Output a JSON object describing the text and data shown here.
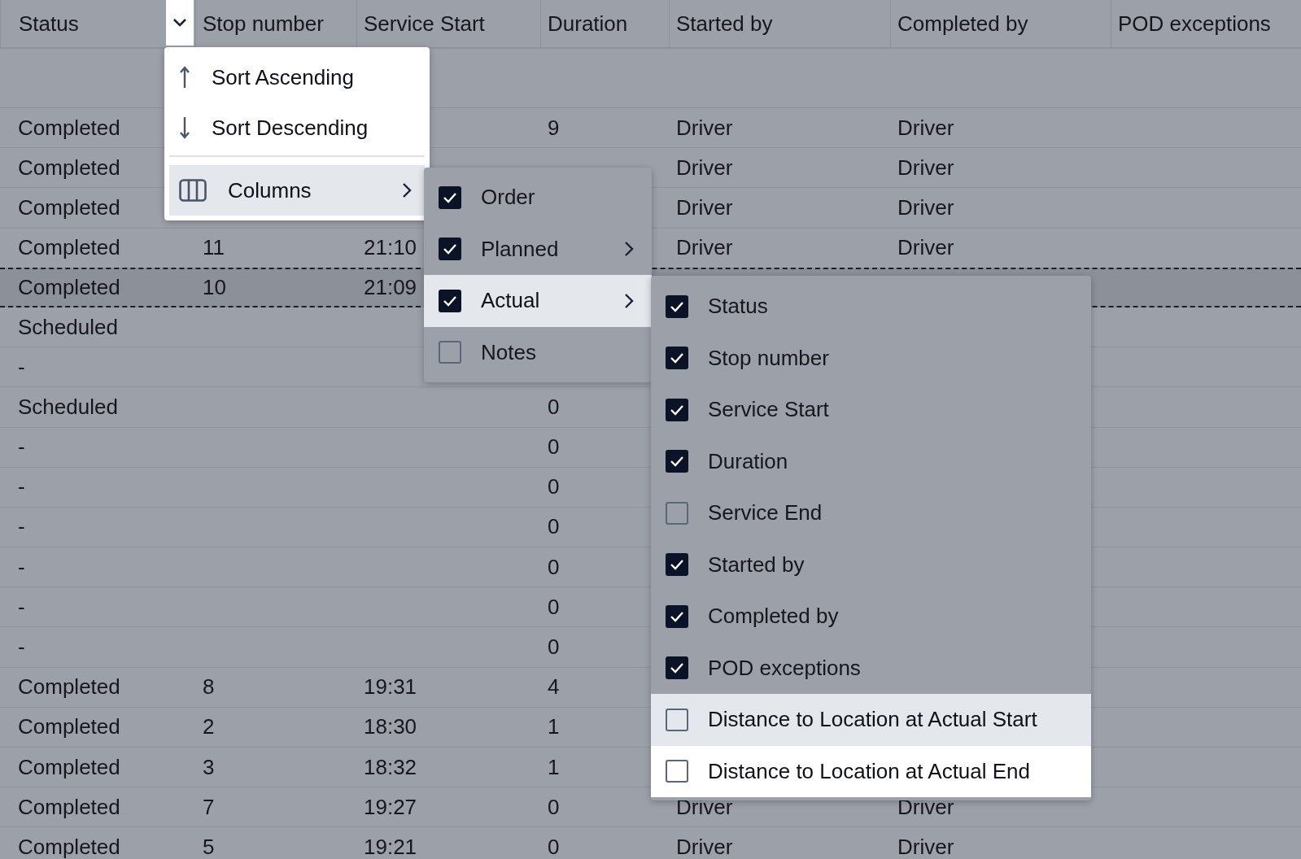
{
  "table": {
    "columns": [
      "Status",
      "Stop number",
      "Service Start",
      "Duration",
      "Started by",
      "Completed by",
      "POD exceptions"
    ],
    "rows": [
      {
        "status": "Completed",
        "duration": "9",
        "started_by": "Driver",
        "completed_by": "Driver",
        "selected": false
      },
      {
        "status": "Completed",
        "started_by": "Driver",
        "completed_by": "Driver",
        "selected": false
      },
      {
        "status": "Completed",
        "started_by": "Driver",
        "completed_by": "Driver",
        "selected": false
      },
      {
        "status": "Completed",
        "stop_number": "11",
        "service_start": "21:10",
        "started_by": "Driver",
        "completed_by": "Driver",
        "selected": false
      },
      {
        "status": "Completed",
        "stop_number": "10",
        "service_start": "21:09",
        "selected": true
      },
      {
        "status": "Scheduled",
        "selected": false
      },
      {
        "status": "-",
        "selected": false
      },
      {
        "status": "Scheduled",
        "duration": "0",
        "selected": false
      },
      {
        "status": "-",
        "duration": "0",
        "selected": false
      },
      {
        "status": "-",
        "duration": "0",
        "selected": false
      },
      {
        "status": "-",
        "duration": "0",
        "selected": false
      },
      {
        "status": "-",
        "duration": "0",
        "selected": false
      },
      {
        "status": "-",
        "duration": "0",
        "selected": false
      },
      {
        "status": "-",
        "duration": "0",
        "selected": false
      },
      {
        "status": "Completed",
        "stop_number": "8",
        "service_start": "19:31",
        "duration": "4",
        "selected": false
      },
      {
        "status": "Completed",
        "stop_number": "2",
        "service_start": "18:30",
        "duration": "1",
        "selected": false
      },
      {
        "status": "Completed",
        "stop_number": "3",
        "service_start": "18:32",
        "duration": "1",
        "selected": false
      },
      {
        "status": "Completed",
        "stop_number": "7",
        "service_start": "19:27",
        "duration": "0",
        "started_by": "Driver",
        "completed_by": "Driver",
        "selected": false
      },
      {
        "status": "Completed",
        "stop_number": "5",
        "service_start": "19:21",
        "duration": "0",
        "started_by": "Driver",
        "completed_by": "Driver",
        "selected": false
      }
    ]
  },
  "column_menu": {
    "items": [
      {
        "kind": "sort_ascending",
        "label": "Sort Ascending",
        "hovered": false
      },
      {
        "kind": "sort_descending",
        "label": "Sort Descending",
        "hovered": false
      },
      {
        "kind": "columns",
        "label": "Columns",
        "hovered": true
      }
    ]
  },
  "columns_submenu": {
    "items": [
      {
        "label": "Order",
        "checked": true,
        "submenu": false,
        "hovered": false,
        "dimmed": true
      },
      {
        "label": "Planned",
        "checked": true,
        "submenu": true,
        "hovered": false,
        "dimmed": true
      },
      {
        "label": "Actual",
        "checked": true,
        "submenu": true,
        "hovered": true,
        "dimmed": false
      },
      {
        "label": "Notes",
        "checked": false,
        "submenu": false,
        "hovered": false,
        "dimmed": true
      }
    ]
  },
  "actual_submenu": {
    "items": [
      {
        "label": "Status",
        "checked": true,
        "hovered": false,
        "dimmed": true
      },
      {
        "label": "Stop number",
        "checked": true,
        "hovered": false,
        "dimmed": true
      },
      {
        "label": "Service Start",
        "checked": true,
        "hovered": false,
        "dimmed": true
      },
      {
        "label": "Duration",
        "checked": true,
        "hovered": false,
        "dimmed": true
      },
      {
        "label": "Service End",
        "checked": false,
        "hovered": false,
        "dimmed": true
      },
      {
        "label": "Started by",
        "checked": true,
        "hovered": false,
        "dimmed": true
      },
      {
        "label": "Completed by",
        "checked": true,
        "hovered": false,
        "dimmed": true
      },
      {
        "label": "POD exceptions",
        "checked": true,
        "hovered": false,
        "dimmed": true
      },
      {
        "label": "Distance to Location at Actual Start",
        "checked": false,
        "hovered": true,
        "dimmed": false
      },
      {
        "label": "Distance to Location at Actual End",
        "checked": false,
        "hovered": false,
        "dimmed": false
      }
    ]
  }
}
